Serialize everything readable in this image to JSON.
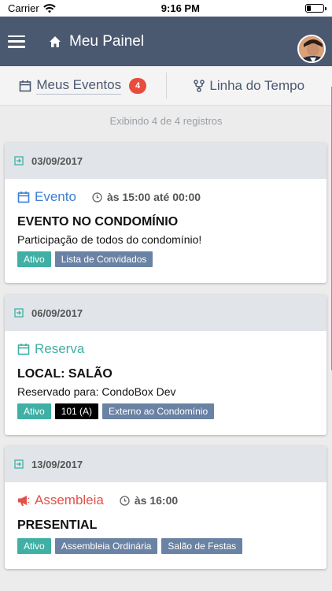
{
  "statusbar": {
    "carrier": "Carrier",
    "time": "9:16 PM"
  },
  "navbar": {
    "title": "Meu Painel"
  },
  "tabs": [
    {
      "label": "Meus Eventos",
      "badge": "4"
    },
    {
      "label": "Linha do Tempo"
    }
  ],
  "records_text": "Exibindo 4 de 4 registros",
  "colors": {
    "nav": "#4b5970",
    "evento": "#3d7fd3",
    "reserva": "#3fb0a3",
    "assembleia": "#e0524a"
  },
  "cards": [
    {
      "date": "03/09/2017",
      "type": "Evento",
      "type_icon": "calendar-icon",
      "time": "às 15:00 até 00:00",
      "title": "EVENTO NO CONDOMÍNIO",
      "desc": "Participação de todos do condomínio!",
      "tags": [
        "Ativo",
        "Lista de Convidados"
      ]
    },
    {
      "date": "06/09/2017",
      "type": "Reserva",
      "type_icon": "calendar-icon",
      "title": "LOCAL: SALÃO",
      "desc": "Reservado para: CondoBox Dev",
      "tags": [
        "Ativo",
        "101 (A)",
        "Externo ao Condomínio"
      ]
    },
    {
      "date": "13/09/2017",
      "type": "Assembleia",
      "type_icon": "megaphone-icon",
      "time": "às 16:00",
      "title": "PRESENTIAL",
      "tags": [
        "Ativo",
        "Assembleia Ordinária",
        "Salão de Festas"
      ]
    }
  ]
}
